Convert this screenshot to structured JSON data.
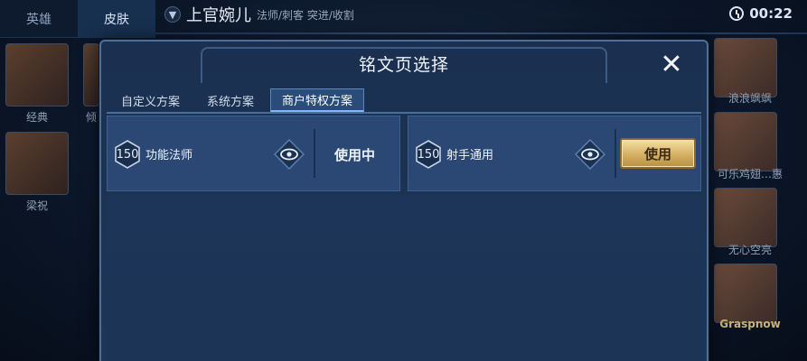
{
  "top_tabs": [
    {
      "label": "英雄"
    },
    {
      "label": "皮肤"
    }
  ],
  "hero": {
    "name": "上官婉儿",
    "roles": "法师/刺客 突进/收割"
  },
  "timer": {
    "value": "00:22"
  },
  "left_skins": [
    {
      "label": "经典"
    },
    {
      "label": "倾"
    },
    {
      "label": "梁祝"
    }
  ],
  "right_skins": [
    {
      "label": "浪浪飒飒"
    },
    {
      "label": "可乐鸡翅…惠"
    },
    {
      "label": "无心空亮"
    },
    {
      "label": "Graspnow"
    }
  ],
  "modal": {
    "title": "铭文页选择",
    "close_glyph": "✕",
    "tabs": [
      {
        "label": "自定义方案"
      },
      {
        "label": "系统方案"
      },
      {
        "label": "商户特权方案"
      }
    ],
    "active_tab_index": 2,
    "pages": [
      {
        "level": "150",
        "name": "功能法师",
        "status": "使用中",
        "in_use": true
      },
      {
        "level": "150",
        "name": "射手通用",
        "button_label": "使用",
        "in_use": false
      }
    ]
  },
  "colors": {
    "accent_gold": "#d8b468",
    "panel_blue": "#2a4873",
    "active_tab": "#2a4c78"
  },
  "icons": {
    "eye": "eye-icon",
    "close": "close-icon",
    "clock": "clock-icon",
    "level": "level-badge-icon"
  }
}
